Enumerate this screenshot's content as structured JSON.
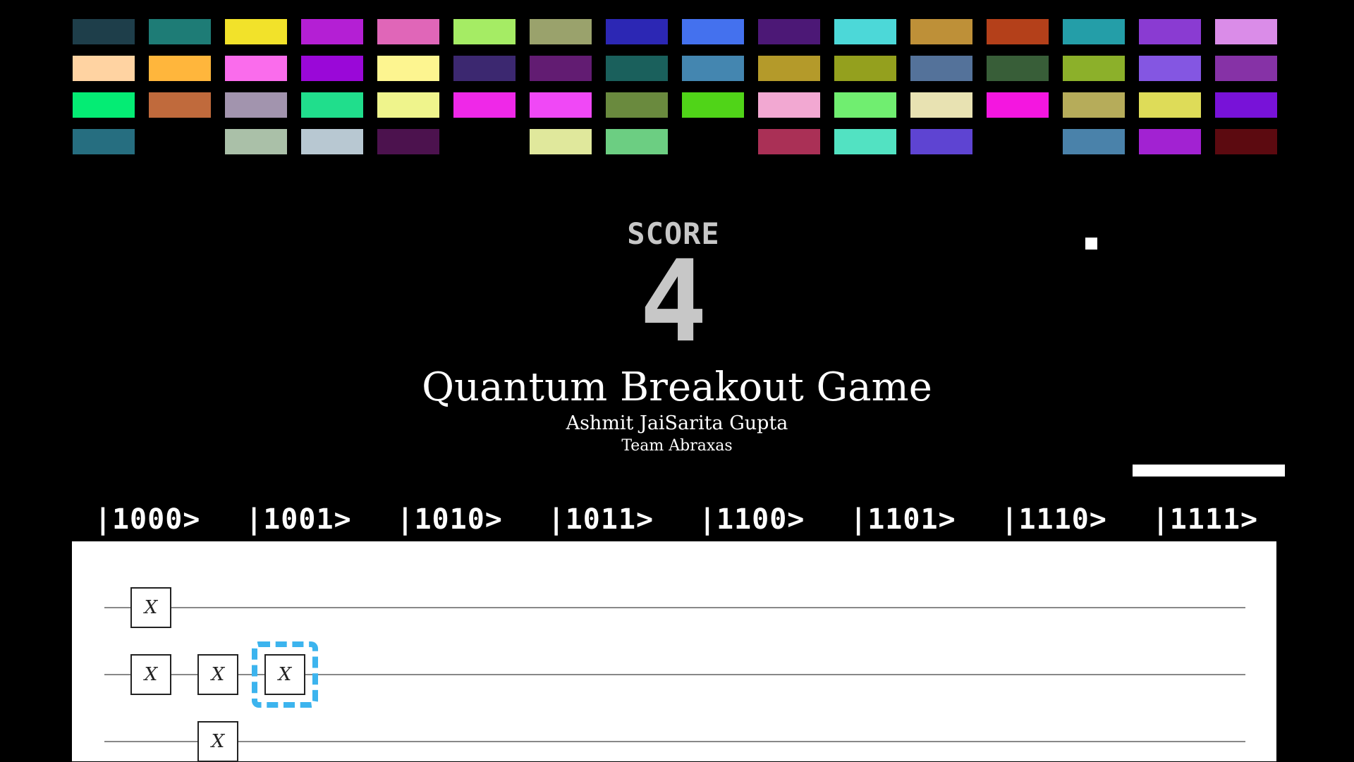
{
  "bricks": {
    "columns": 16,
    "rows": [
      [
        "#1e3e4a",
        "#1e7c76",
        "#f2e22a",
        "#b41fd4",
        "#e066b8",
        "#a5ec64",
        "#9aa26c",
        "#2c27b4",
        "#4471ee",
        "#4c1876",
        "#4cd8d8",
        "#be9038",
        "#b4401a",
        "#249ea8",
        "#8a3bd2",
        "#da8ce8"
      ],
      [
        "#ffd3a2",
        "#ffb63c",
        "#fa6cec",
        "#9a08d8",
        "#fdf590",
        "#3c2870",
        "#621c72",
        "#1a605c",
        "#4486b0",
        "#b49a2a",
        "#94a01e",
        "#54729a",
        "#385e38",
        "#8cb02a",
        "#8456e2",
        "#8632a6"
      ],
      [
        "#04ec74",
        "#c06a3c",
        "#a294ae",
        "#20de8c",
        "#eff48c",
        "#ef28e8",
        "#f048f6",
        "#6a8a3e",
        "#50d418",
        "#f2a8d2",
        "#70ee70",
        "#e8e2b2",
        "#f416e0",
        "#b6ac5a",
        "#dedc58",
        "#7812d8"
      ],
      [
        "#266e80",
        null,
        "#aac0a8",
        "#b8c8d2",
        "#4c124e",
        null,
        "#e0e89c",
        "#6cce82",
        null,
        "#aa3056",
        "#52e2c2",
        "#5e44d2",
        null,
        "#4a82aa",
        "#a222d2",
        "#5c0a10"
      ]
    ]
  },
  "score": {
    "label": "SCORE",
    "value": "4"
  },
  "title": "Quantum Breakout Game",
  "author": "Ashmit JaiSarita Gupta",
  "team": "Team Abraxas",
  "basis_states": [
    "|1000>",
    "|1001>",
    "|1010>",
    "|1011>",
    "|1100>",
    "|1101>",
    "|1110>",
    "|1111>"
  ],
  "circuit": {
    "gates": [
      {
        "qubit": 0,
        "column": 0,
        "label": "X",
        "selected": false
      },
      {
        "qubit": 1,
        "column": 0,
        "label": "X",
        "selected": false
      },
      {
        "qubit": 1,
        "column": 1,
        "label": "X",
        "selected": false
      },
      {
        "qubit": 1,
        "column": 2,
        "label": "X",
        "selected": true
      },
      {
        "qubit": 2,
        "column": 1,
        "label": "X",
        "selected": false
      }
    ],
    "visible_wires": 3,
    "selection_color": "#3cb4ee"
  }
}
